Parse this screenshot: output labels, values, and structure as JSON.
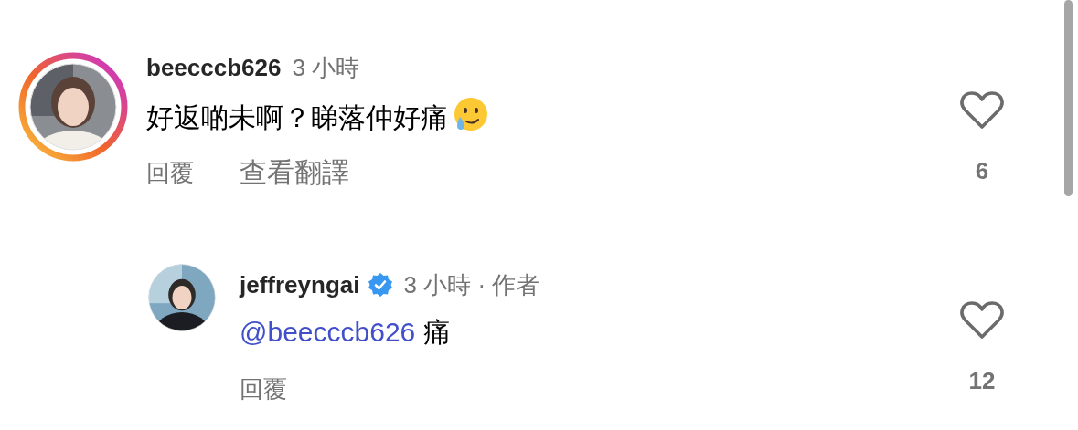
{
  "comments": [
    {
      "username": "beecccb626",
      "verified": false,
      "story_ring": true,
      "meta": "3 小時",
      "text": "好返啲未啊？睇落仲好痛",
      "tear_emoji": true,
      "actions": [
        "回覆",
        "查看翻譯"
      ],
      "likes": "6",
      "liked": false,
      "replies": [
        {
          "username": "jeffreyngai",
          "verified": true,
          "story_ring": false,
          "meta": "3 小時 · 作者",
          "mention": "@beecccb626",
          "text": "痛",
          "actions": [
            "回覆"
          ],
          "likes": "12",
          "liked": false
        }
      ]
    }
  ]
}
